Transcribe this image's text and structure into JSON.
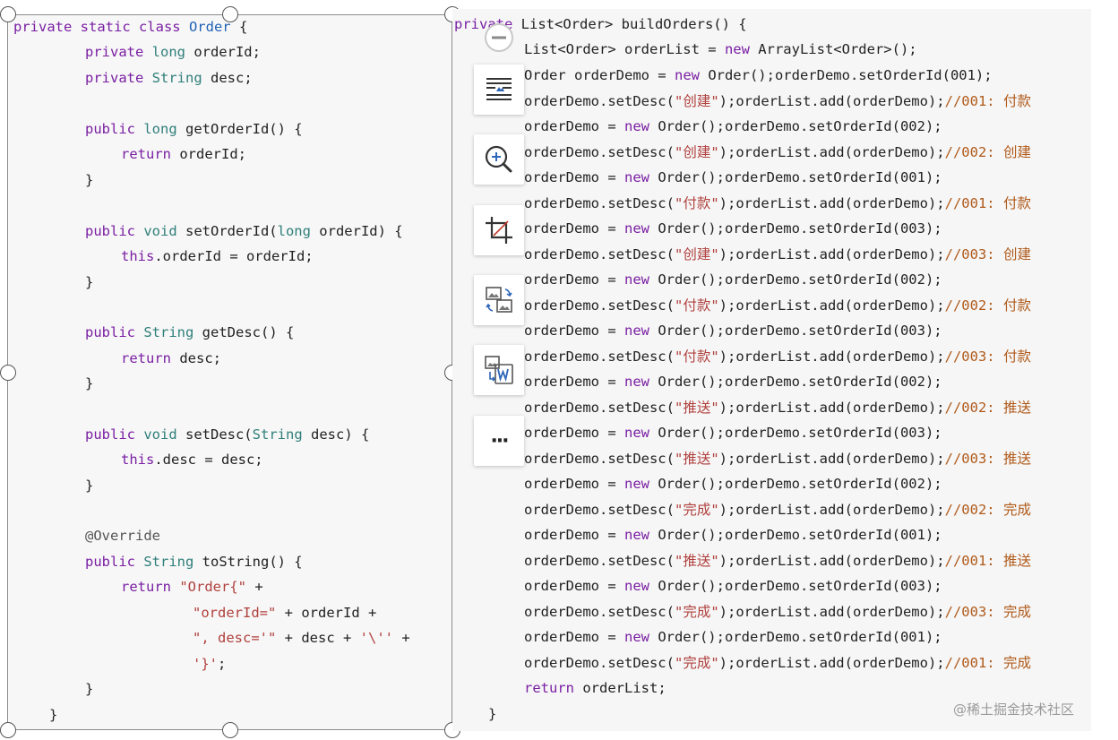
{
  "left_code": {
    "l1": [
      "private static class ",
      "Order",
      " {"
    ],
    "l2": [
      "private ",
      "long",
      " orderId;"
    ],
    "l3": [
      "private ",
      "String",
      " desc;"
    ],
    "l4": [
      "public ",
      "long",
      " getOrderId() {"
    ],
    "l5": [
      "return",
      " orderId;"
    ],
    "l6": "}",
    "l7": [
      "public ",
      "void",
      " setOrderId(",
      "long",
      " orderId) {"
    ],
    "l8": [
      "this",
      ".orderId = orderId;"
    ],
    "l9": "}",
    "l10": [
      "public ",
      "String",
      " getDesc() {"
    ],
    "l11": [
      "return",
      " desc;"
    ],
    "l12": "}",
    "l13": [
      "public ",
      "void",
      " setDesc(",
      "String",
      " desc) {"
    ],
    "l14": [
      "this",
      ".desc = desc;"
    ],
    "l15": "}",
    "l16": "@Override",
    "l17": [
      "public ",
      "String",
      " toString() {"
    ],
    "l18": [
      "return ",
      "\"Order{\"",
      " +"
    ],
    "l19": [
      "\"orderId=\"",
      " + orderId +"
    ],
    "l20": [
      "\", desc='\"",
      " + desc + ",
      "'\\''",
      " +"
    ],
    "l21": [
      "'}'",
      ";"
    ],
    "l22": "}",
    "l23": "}"
  },
  "right_code": {
    "header": [
      "private",
      " List<Order> buildOrders() {"
    ],
    "decl": [
      "List<Order> orderList = ",
      "new",
      " ArrayList<Order>();"
    ],
    "first": [
      "Order orderDemo = ",
      "new",
      " Order();orderDemo.setOrderId(001);"
    ],
    "pairs": [
      {
        "id": "001",
        "desc": "\"创建\"",
        "comment": "//001: 付款"
      },
      {
        "id": "002",
        "desc": "\"创建\"",
        "comment": "//002: 创建"
      },
      {
        "id": "001",
        "desc": "\"付款\"",
        "comment": "//001: 付款"
      },
      {
        "id": "003",
        "desc": "\"创建\"",
        "comment": "//003: 创建"
      },
      {
        "id": "002",
        "desc": "\"付款\"",
        "comment": "//002: 付款"
      },
      {
        "id": "003",
        "desc": "\"付款\"",
        "comment": "//003: 付款"
      },
      {
        "id": "002",
        "desc": "\"推送\"",
        "comment": "//002: 推送"
      },
      {
        "id": "003",
        "desc": "\"推送\"",
        "comment": "//003: 推送"
      },
      {
        "id": "002",
        "desc": "\"完成\"",
        "comment": "//002: 完成"
      },
      {
        "id": "001",
        "desc": "\"推送\"",
        "comment": "//001: 推送"
      },
      {
        "id": "003",
        "desc": "\"完成\"",
        "comment": "//003: 完成"
      },
      {
        "id": "001",
        "desc": "\"完成\"",
        "comment": "//001: 完成"
      }
    ],
    "text_new_order": "orderDemo = ",
    "text_new_kw": "new",
    "text_order_call_prefix": " Order();orderDemo.setOrderId(",
    "text_setdesc_prefix": "orderDemo.setDesc(",
    "text_add": ");orderList.add(orderDemo);",
    "ret": [
      "return",
      " orderList;"
    ],
    "close": "}"
  },
  "toolbar": {
    "zoom_out_icon": "minus-circle-icon",
    "tools": [
      {
        "icon": "text-wrap-icon",
        "name": "wrap-text"
      },
      {
        "icon": "zoom-in-icon",
        "name": "zoom-in"
      },
      {
        "icon": "crop-icon",
        "name": "crop"
      },
      {
        "icon": "image-convert-icon",
        "name": "image-convert"
      },
      {
        "icon": "copy-to-word-icon",
        "name": "copy-to-word"
      },
      {
        "icon": "more-icon",
        "name": "more"
      }
    ],
    "more_label": "···"
  },
  "watermark": "@稀土掘金技术社区"
}
